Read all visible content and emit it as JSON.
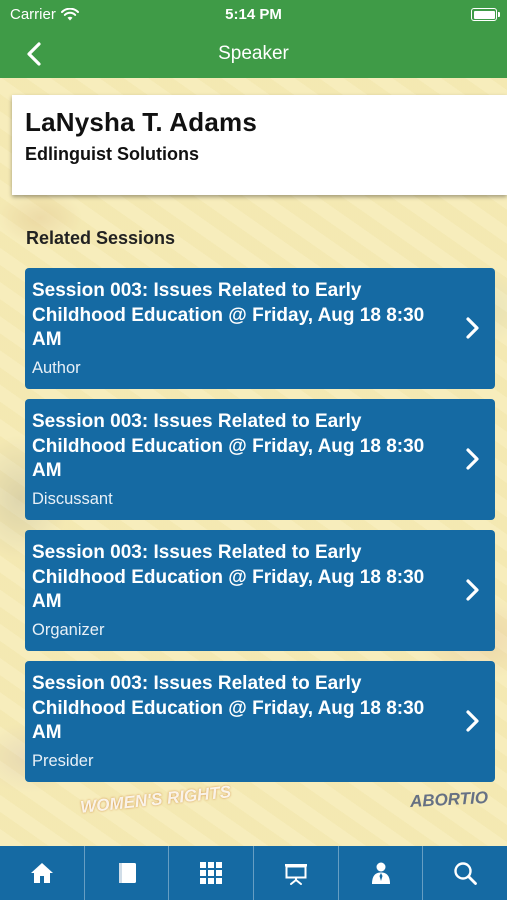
{
  "status_bar": {
    "carrier": "Carrier",
    "time": "5:14 PM"
  },
  "nav": {
    "title": "Speaker",
    "back_icon": "chevron-left-icon"
  },
  "speaker": {
    "name": "LaNysha T. Adams",
    "organization": "Edlinguist Solutions"
  },
  "related_sessions": {
    "heading": "Related Sessions",
    "items": [
      {
        "title": "Session 003: Issues Related to Early Childhood Education @ Friday, Aug 18 8:30 AM",
        "role": "Author"
      },
      {
        "title": "Session 003: Issues Related to Early Childhood Education @ Friday, Aug 18 8:30 AM",
        "role": "Discussant"
      },
      {
        "title": "Session 003: Issues Related to Early Childhood Education @ Friday, Aug 18 8:30 AM",
        "role": "Organizer"
      },
      {
        "title": "Session 003: Issues Related to Early Childhood Education @ Friday, Aug 18 8:30 AM",
        "role": "Presider"
      }
    ]
  },
  "background": {
    "poster_texts": [
      "WOMEN'S RIGHTS",
      "ABORTIO"
    ]
  },
  "tab_bar": {
    "items": [
      "home-icon",
      "book-icon",
      "grid-icon",
      "presentation-icon",
      "person-icon",
      "search-icon"
    ]
  },
  "colors": {
    "header_green": "#3f9b47",
    "session_blue": "#156aa3",
    "tab_bar_blue": "#156aa3"
  }
}
